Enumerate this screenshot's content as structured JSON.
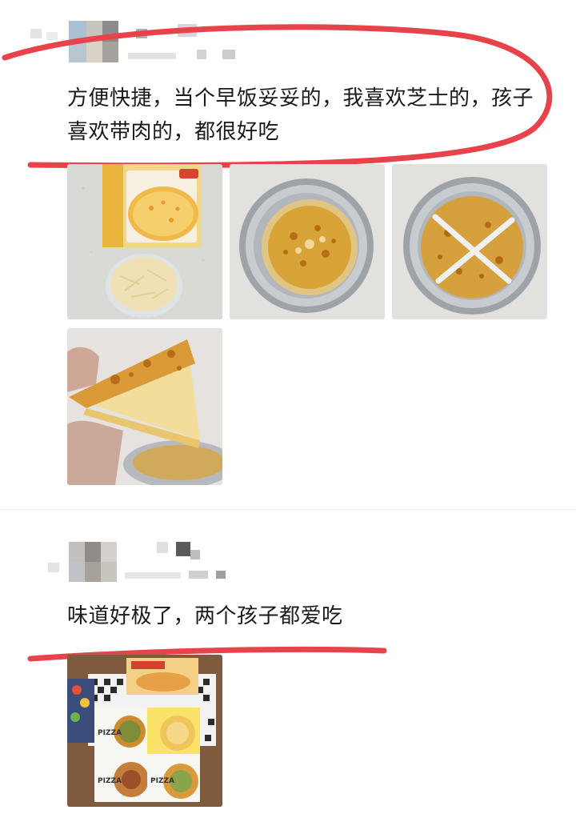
{
  "reviews": [
    {
      "text": "方便快捷，当个早饭妥妥的，我喜欢芝士的，孩子喜欢带肉的，都很好吃",
      "photos": [
        {
          "icon": "pizza-box-and-cheese-photo"
        },
        {
          "icon": "pizza-in-foil-tray-photo"
        },
        {
          "icon": "sliced-pizza-in-foil-tray-photo"
        },
        {
          "icon": "pizza-slice-in-hand-photo"
        }
      ]
    },
    {
      "text": "味道好极了，两个孩子都爱吃",
      "photos": [
        {
          "icon": "pizza-boxes-photo",
          "box_label": "PIZZA"
        }
      ]
    }
  ],
  "colors": {
    "highlight_ink": "#e8424a",
    "divider": "#eeeeee"
  }
}
